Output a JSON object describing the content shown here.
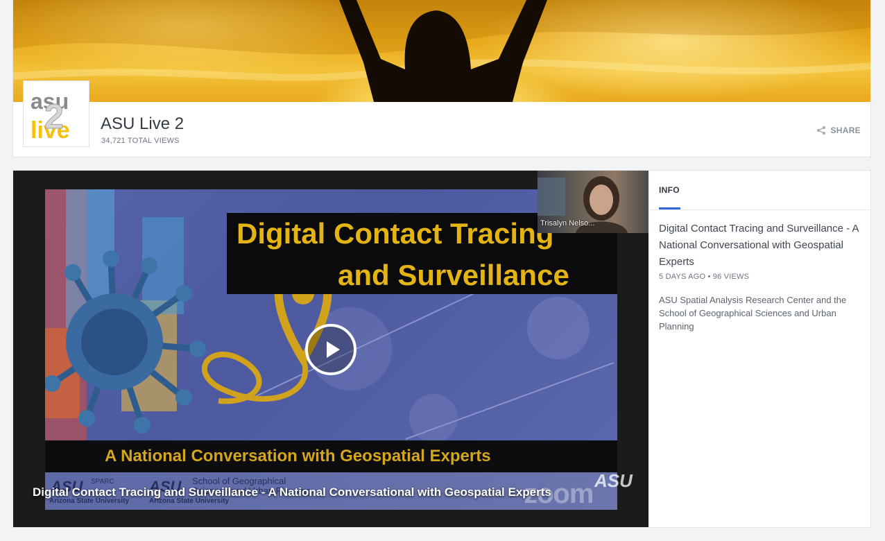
{
  "channel": {
    "title": "ASU Live 2",
    "total_views": "34,721 TOTAL VIEWS",
    "share_label": "SHARE",
    "logo_text": "asu",
    "logo_num": "2",
    "logo_live": "live"
  },
  "player": {
    "slide_title_line1": "Digital Contact Tracing",
    "slide_title_line2": "and Surveillance",
    "slide_subtitle": "A National Conversation with Geospatial Experts",
    "footer_asu_logo_1": "ASU",
    "footer_sparc": "SPARC",
    "footer_asu_1": "Arizona State University",
    "footer_asu_logo_2": "ASU",
    "footer_sgs": "School of Geographical Sciences and Urban Planning",
    "footer_asu_2": "Arizona State University",
    "webcam_name": "Trisalyn Nelso...",
    "caption": "Digital Contact Tracing and Surveillance - A National Conversational with Geospatial Experts",
    "zoom_watermark": "zoom",
    "asu_watermark": "ASU"
  },
  "info": {
    "tab_label": "INFO",
    "title": "Digital Contact Tracing and Surveillance - A National Conversational with Geospatial Experts",
    "meta": "5 DAYS AGO • 96 VIEWS",
    "description": "ASU Spatial Analysis Research Center and the School of Geographical Sciences and Urban Planning"
  },
  "colors": {
    "accent": "#2f6ad8",
    "slide_text": "#e4b413",
    "logo_yellow": "#f4c20d"
  }
}
